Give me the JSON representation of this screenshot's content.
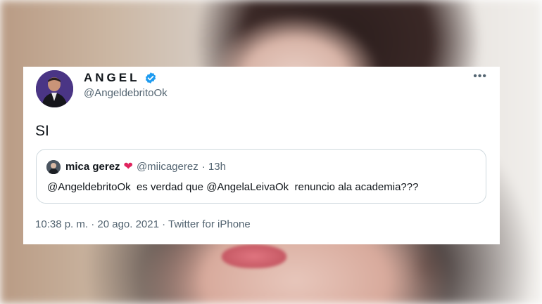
{
  "tweet": {
    "author_name": "ANGEL",
    "author_handle": "@AngeldebritoOk",
    "more_label": "•••",
    "text": "SI",
    "timestamp": "10:38 p. m. · 20 ago. 2021 · Twitter for iPhone"
  },
  "quoted": {
    "author_name": "mica gerez",
    "heart_emoji": "❤",
    "author_handle": "@miicagerez",
    "time": "· 13h",
    "text": "@AngeldebritoOk  es verdad que @AngelaLeivaOk  renuncio ala academia???"
  },
  "colors": {
    "verified": "#1d9bf0",
    "secondary_text": "#536471",
    "primary_text": "#0f1419",
    "heart": "#e0245e"
  }
}
